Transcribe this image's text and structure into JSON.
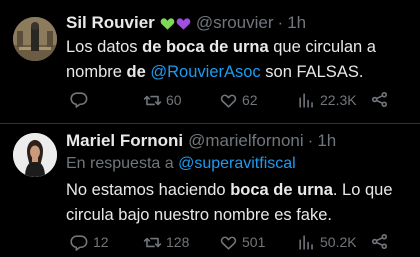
{
  "tweets": [
    {
      "name": "Sil Rouvier",
      "handle": "@srouvier",
      "dot": "·",
      "time": "1h",
      "emoji_colors": [
        "#7ed957",
        "#a24ee0"
      ],
      "body": {
        "line1_a": "Los datos ",
        "line1_b": "de boca de urna",
        "line1_c": " que circulan a",
        "line2_a": "nombre ",
        "line2_b": "de",
        "line2_c": " ",
        "line2_link": "@RouvierAsoc",
        "line2_d": " son FALSAS."
      },
      "stats": {
        "replies": "",
        "retweets": "60",
        "likes": "62",
        "views": "22.3K"
      }
    },
    {
      "name": "Mariel Fornoni",
      "handle": "@marielfornoni",
      "dot": "·",
      "time": "1h",
      "reply_to_prefix": "En respuesta a ",
      "reply_to_handle": "@superavitfiscal",
      "body": {
        "line1_a": "No estamos haciendo ",
        "line1_b": "boca de urna",
        "line1_c": ". Lo que",
        "line2_a": "circula bajo nuestro nombre es fake."
      },
      "stats": {
        "replies": "12",
        "retweets": "128",
        "likes": "501",
        "views": "50.2K"
      }
    }
  ],
  "colors": {
    "background": "#000000",
    "text": "#e7e9ea",
    "muted": "#71767b",
    "link": "#1d9bf0",
    "divider": "#2f3336"
  },
  "icons": {
    "reply": "reply-icon",
    "retweet": "retweet-icon",
    "like": "heart-icon",
    "views": "views-icon",
    "share": "share-icon"
  }
}
